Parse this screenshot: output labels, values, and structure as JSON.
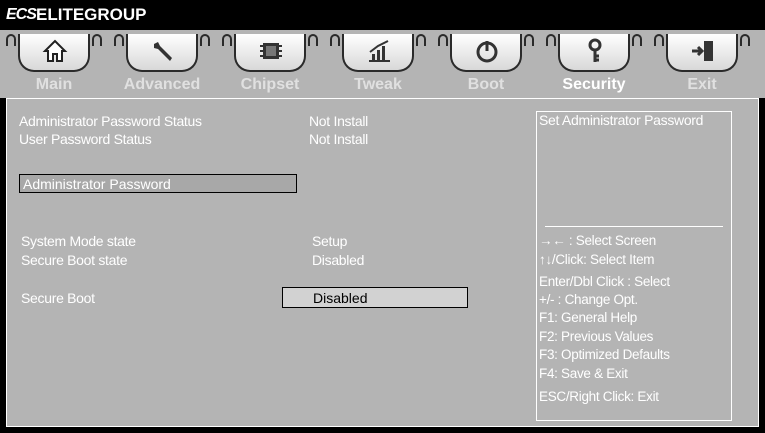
{
  "brand": {
    "logo_text": "ECS",
    "name": "ELITEGROUP"
  },
  "tabs": [
    {
      "label": "Main",
      "icon": "home-icon"
    },
    {
      "label": "Advanced",
      "icon": "wrench-icon"
    },
    {
      "label": "Chipset",
      "icon": "chip-icon"
    },
    {
      "label": "Tweak",
      "icon": "chart-icon"
    },
    {
      "label": "Boot",
      "icon": "power-icon"
    },
    {
      "label": "Security",
      "icon": "key-icon",
      "active": true
    },
    {
      "label": "Exit",
      "icon": "exit-icon"
    }
  ],
  "security": {
    "admin_status_label": "Administrator Password Status",
    "admin_status_value": "Not Install",
    "user_status_label": "User Password Status",
    "user_status_value": "Not Install",
    "admin_password_label": "Administrator  Password",
    "system_mode_label": "System Mode state",
    "system_mode_value": "Setup",
    "secure_boot_state_label": "Secure Boot state",
    "secure_boot_state_value": "Disabled",
    "secure_boot_label": "Secure Boot",
    "secure_boot_value": "Disabled"
  },
  "help": {
    "description": "Set Administrator Password",
    "keys": [
      "→←   : Select Screen",
      "↑↓/Click: Select Item",
      "Enter/Dbl Click : Select",
      "+/- : Change Opt.",
      "F1: General Help",
      "F2: Previous Values",
      "F3: Optimized Defaults",
      "F4: Save & Exit",
      "ESC/Right Click: Exit"
    ]
  },
  "colors": {
    "background": "#b4b4b4",
    "text": "#ffffff",
    "header": "#000000"
  }
}
